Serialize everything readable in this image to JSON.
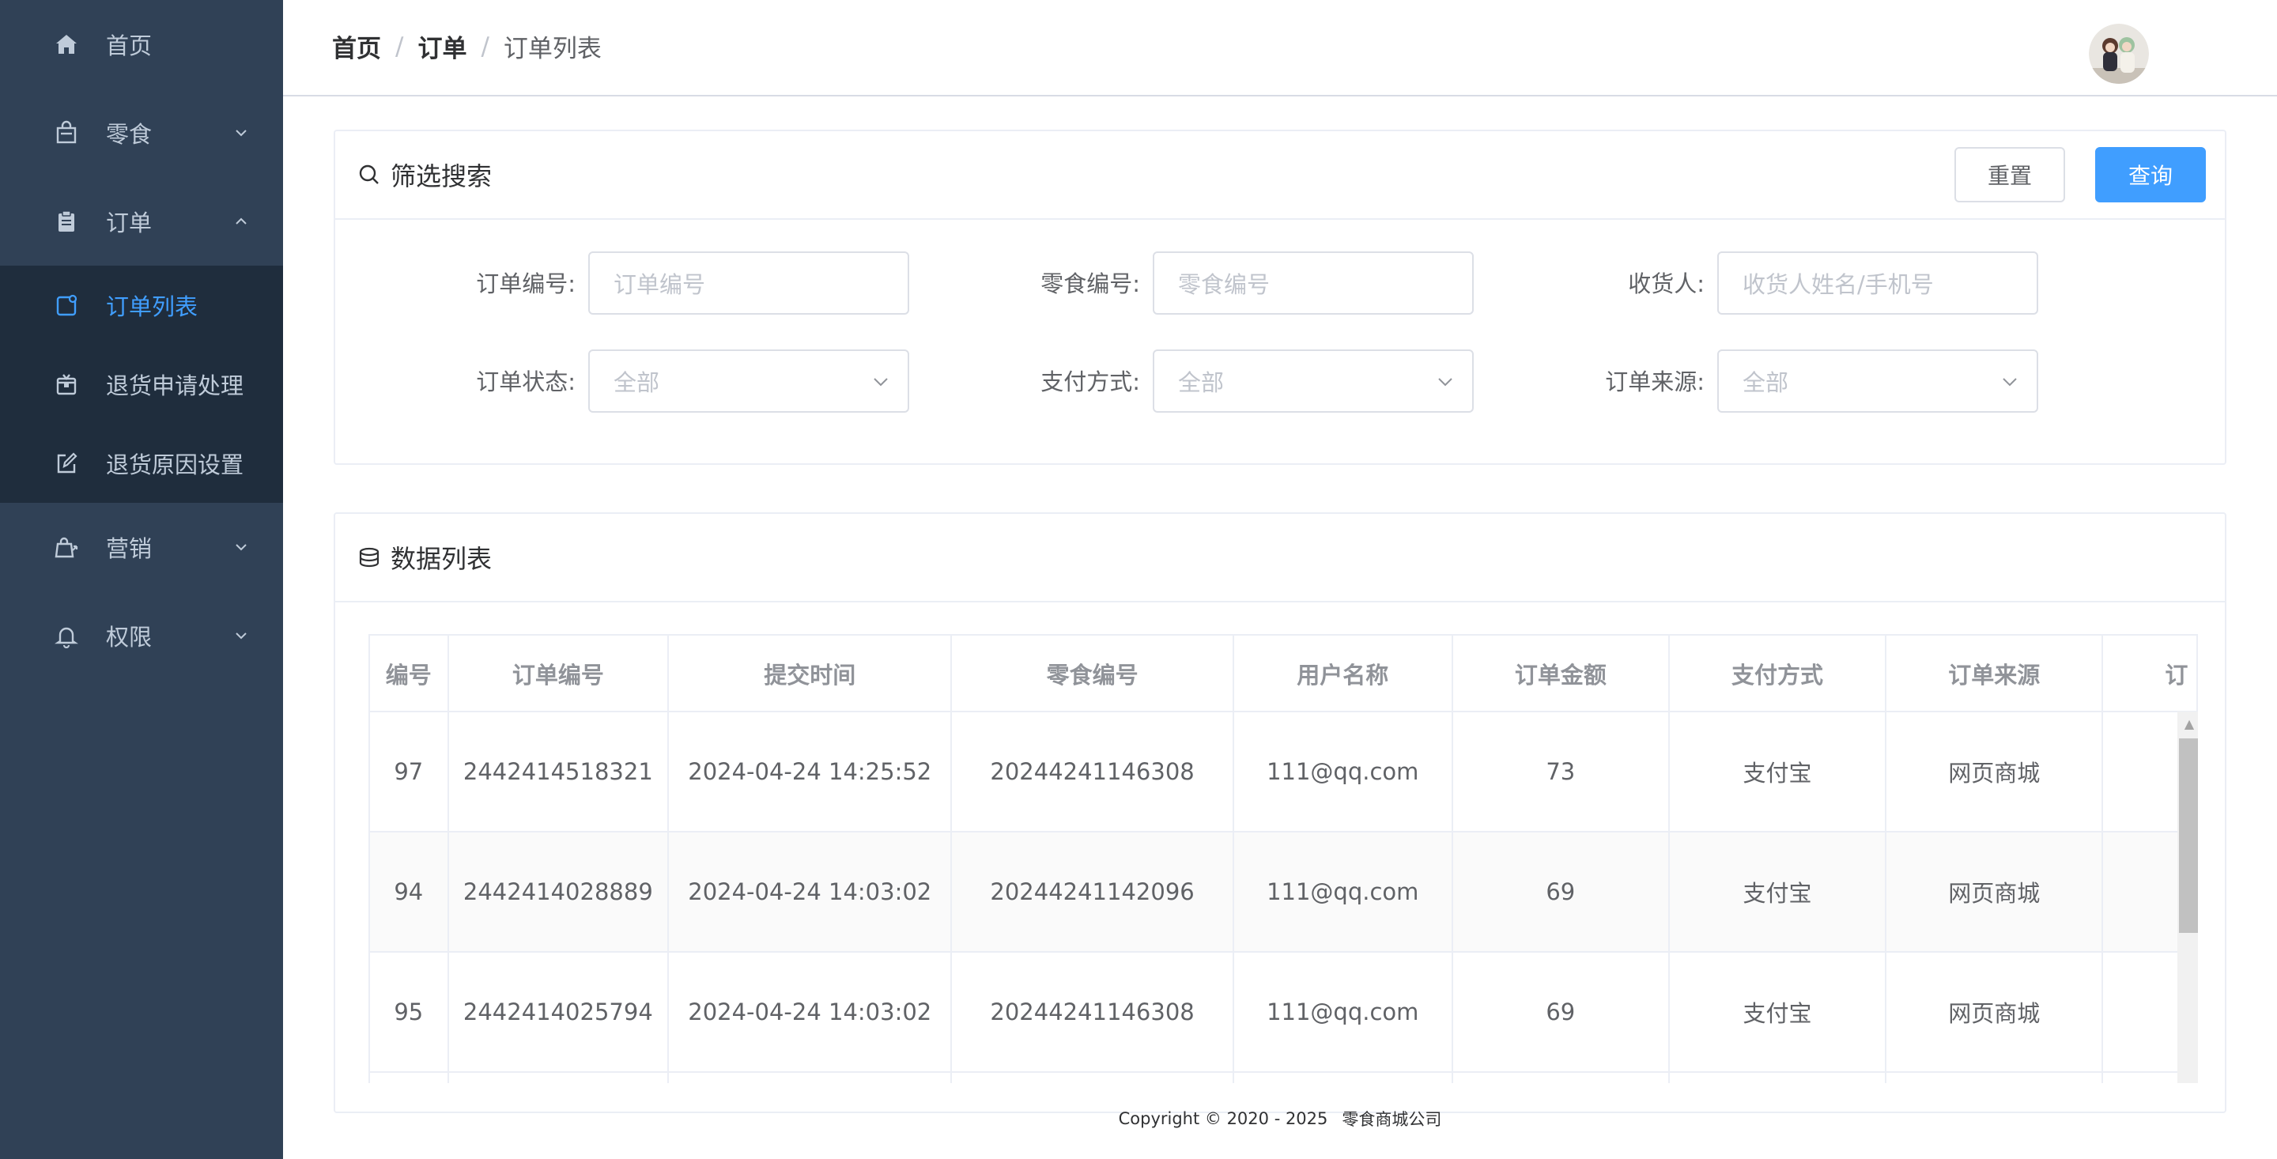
{
  "sidebar": {
    "items": [
      {
        "label": "首页",
        "icon": "home-icon"
      },
      {
        "label": "零食",
        "icon": "bag-icon"
      },
      {
        "label": "订单",
        "icon": "clipboard-icon"
      },
      {
        "label": "营销",
        "icon": "marketing-icon"
      },
      {
        "label": "权限",
        "icon": "bell-icon"
      }
    ],
    "order_submenu": [
      {
        "label": "订单列表",
        "icon": "order-list-icon",
        "active": true
      },
      {
        "label": "退货申请处理",
        "icon": "return-box-icon"
      },
      {
        "label": "退货原因设置",
        "icon": "edit-icon"
      }
    ]
  },
  "header": {
    "breadcrumb": [
      "首页",
      "订单",
      "订单列表"
    ],
    "separator": "/"
  },
  "filter": {
    "title": "筛选搜索",
    "reset_label": "重置",
    "query_label": "查询",
    "fields": {
      "order_no": {
        "label": "订单编号:",
        "placeholder": "订单编号"
      },
      "snack_no": {
        "label": "零食编号:",
        "placeholder": "零食编号"
      },
      "receiver": {
        "label": "收货人:",
        "placeholder": "收货人姓名/手机号"
      },
      "order_status": {
        "label": "订单状态:",
        "value": "全部"
      },
      "pay_method": {
        "label": "支付方式:",
        "value": "全部"
      },
      "order_source": {
        "label": "订单来源:",
        "value": "全部"
      }
    }
  },
  "datalist": {
    "title": "数据列表",
    "columns": [
      "编号",
      "订单编号",
      "提交时间",
      "零食编号",
      "用户名称",
      "订单金额",
      "支付方式",
      "订单来源",
      "订"
    ],
    "rows": [
      [
        "97",
        "2442414518321",
        "2024-04-24 14:25:52",
        "20244241146308",
        "111@qq.com",
        "73",
        "支付宝",
        "网页商城"
      ],
      [
        "94",
        "2442414028889",
        "2024-04-24 14:03:02",
        "20244241142096",
        "111@qq.com",
        "69",
        "支付宝",
        "网页商城"
      ],
      [
        "95",
        "2442414025794",
        "2024-04-24 14:03:02",
        "20244241146308",
        "111@qq.com",
        "69",
        "支付宝",
        "网页商城"
      ]
    ]
  },
  "footer": {
    "copyright": "Copyright © 2020 - 2025",
    "company": "零食商城公司"
  },
  "colors": {
    "sidebar_bg": "#304156",
    "submenu_bg": "#1f2d3d",
    "accent": "#409eff"
  }
}
